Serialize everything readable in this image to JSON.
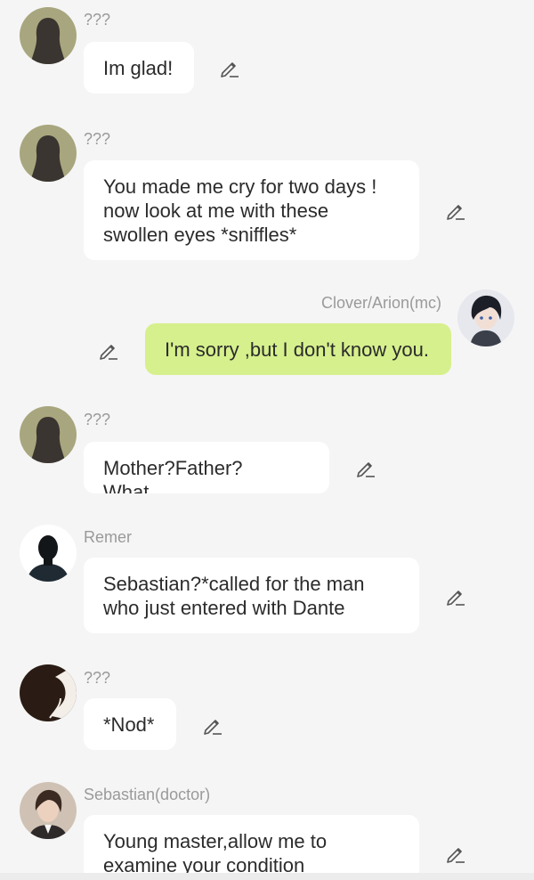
{
  "messages": [
    {
      "sender": "???",
      "text": "Im glad!",
      "avatar_icon": "shadow-woman-avatar"
    },
    {
      "sender": "???",
      "text": "You made me cry for two days  !\nnow look at me with these\nswollen eyes *sniffles*",
      "avatar_icon": "shadow-woman-avatar"
    },
    {
      "sender": "Clover/Arion(mc)",
      "text": "I'm sorry ,but I don't know you.",
      "avatar_icon": "dark-haired-boy-avatar"
    },
    {
      "sender": "???",
      "text": "Mother?Father? What...",
      "avatar_icon": "shadow-woman-avatar"
    },
    {
      "sender": "Remer",
      "text": "Sebastian?*called for the man\nwho just entered with Dante",
      "avatar_icon": "silhouette-man-avatar"
    },
    {
      "sender": "???",
      "text": "*Nod*",
      "avatar_icon": "shadow-profile-avatar"
    },
    {
      "sender": "Sebastian(doctor)",
      "text": "Young master,allow me to\nexamine your condition",
      "avatar_icon": "doctor-man-avatar"
    }
  ],
  "edit_icon": "pencil-edit-icon",
  "colors": {
    "background": "#f5f5f5",
    "bubble_other": "#ffffff",
    "bubble_mine": "#d6f08d",
    "name_text": "#9a9a9a"
  }
}
